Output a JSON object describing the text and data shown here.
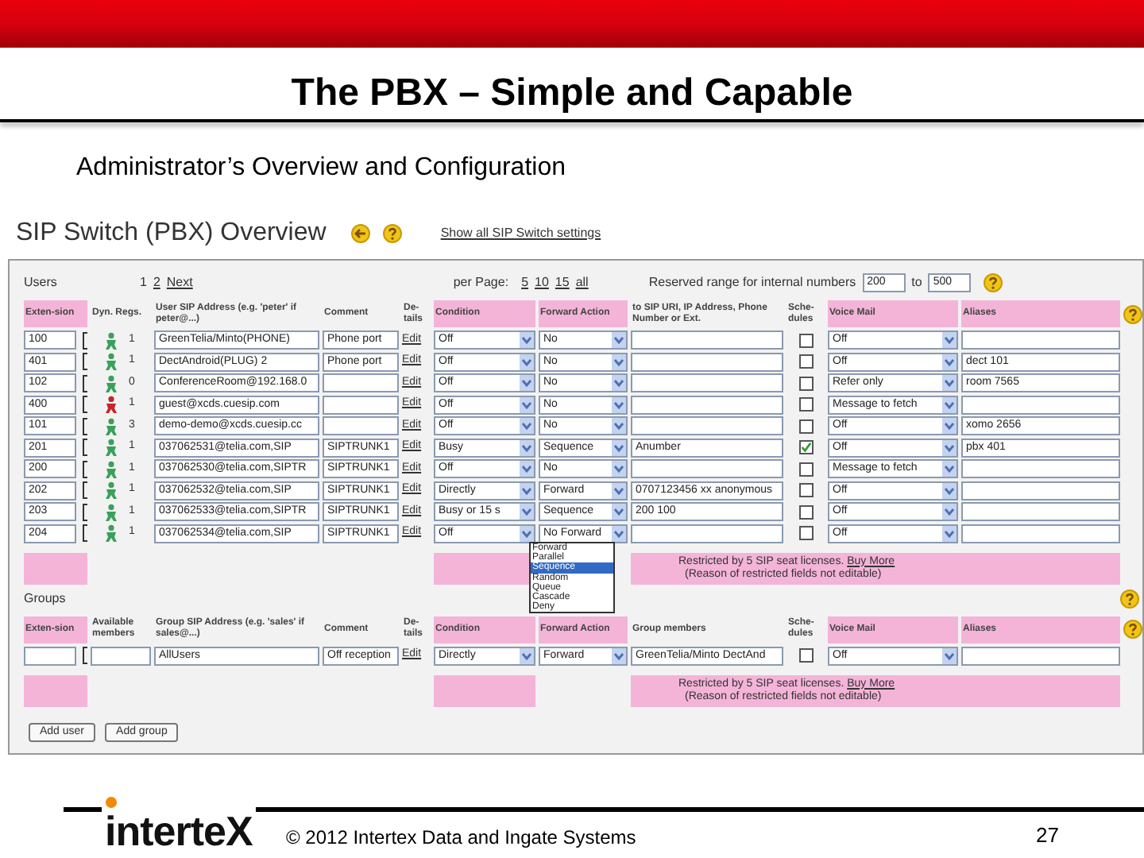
{
  "slide": {
    "title": "The PBX – Simple and Capable",
    "subtitle": "Administrator’s Overview and Configuration"
  },
  "app": {
    "title": "SIP Switch (PBX) Overview",
    "settings_link": "Show all SIP Switch settings",
    "users": {
      "heading": "Users",
      "pages": [
        {
          "label": "1",
          "selected": true
        },
        {
          "label": "2",
          "selected": false
        },
        {
          "label": "Next",
          "selected": false
        }
      ],
      "per_page_label": "per Page:",
      "per_page": [
        "5",
        "10",
        "15",
        "all"
      ],
      "reserved_label": "Reserved range for internal numbers",
      "reserved_from": "200",
      "reserved_to_label": "to",
      "reserved_to": "500",
      "columns": [
        {
          "label": "Exten-sion",
          "highlighted": true
        },
        {
          "label": "Dyn. Regs.",
          "highlighted": false
        },
        {
          "label": "User SIP Address (e.g. 'peter' if peter@...)",
          "highlighted": false
        },
        {
          "label": "Comment",
          "highlighted": false
        },
        {
          "label": "De-tails",
          "highlighted": false
        },
        {
          "label": "Condition",
          "highlighted": true
        },
        {
          "label": "Forward Action",
          "highlighted": true
        },
        {
          "label": "to SIP URI, IP Address, Phone Number or Ext.",
          "highlighted": false
        },
        {
          "label": "Sche-dules",
          "highlighted": false
        },
        {
          "label": "Voice Mail",
          "highlighted": true
        },
        {
          "label": "Aliases",
          "highlighted": true
        }
      ],
      "rows": [
        {
          "extension": "100",
          "registered": true,
          "regs": "1",
          "sip": "GreenTelia/Minto(PHONE)",
          "comment": "Phone port",
          "details": "Edit",
          "condition": "Off",
          "forward": "No",
          "to": "",
          "schedule": false,
          "voicemail": "Off",
          "alias": ""
        },
        {
          "extension": "401",
          "registered": true,
          "regs": "1",
          "sip": "DectAndroid(PLUG) 2",
          "comment": "Phone port",
          "details": "Edit",
          "condition": "Off",
          "forward": "No",
          "to": "",
          "schedule": false,
          "voicemail": "Off",
          "alias": "dect 101"
        },
        {
          "extension": "102",
          "registered": true,
          "regs": "0",
          "sip": "ConferenceRoom@192.168.0",
          "comment": "",
          "details": "Edit",
          "condition": "Off",
          "forward": "No",
          "to": "",
          "schedule": false,
          "voicemail": "Refer only",
          "alias": "room 7565"
        },
        {
          "extension": "400",
          "registered": false,
          "regs": "1",
          "sip": "guest@xcds.cuesip.com",
          "comment": "",
          "details": "Edit",
          "condition": "Off",
          "forward": "No",
          "to": "",
          "schedule": false,
          "voicemail": "Message to fetch",
          "alias": ""
        },
        {
          "extension": "101",
          "registered": true,
          "regs": "3",
          "sip": "demo-demo@xcds.cuesip.cc",
          "comment": "",
          "details": "Edit",
          "condition": "Off",
          "forward": "No",
          "to": "",
          "schedule": false,
          "voicemail": "Off",
          "alias": "xomo 2656"
        },
        {
          "extension": "201",
          "registered": true,
          "regs": "1",
          "sip": "037062531@telia.com,SIP",
          "comment": "SIPTRUNK1",
          "details": "Edit",
          "condition": "Busy",
          "forward": "Sequence",
          "to": "Anumber",
          "schedule": true,
          "voicemail": "Off",
          "alias": "pbx 401"
        },
        {
          "extension": "200",
          "registered": true,
          "regs": "1",
          "sip": "037062530@telia.com,SIPTR",
          "comment": "SIPTRUNK1",
          "details": "Edit",
          "condition": "Off",
          "forward": "No",
          "to": "",
          "schedule": false,
          "voicemail": "Message to fetch",
          "alias": ""
        },
        {
          "extension": "202",
          "registered": true,
          "regs": "1",
          "sip": "037062532@telia.com,SIP",
          "comment": "SIPTRUNK1",
          "details": "Edit",
          "condition": "Directly",
          "forward": "Forward",
          "to": "0707123456 xx anonymous",
          "schedule": false,
          "voicemail": "Off",
          "alias": ""
        },
        {
          "extension": "203",
          "registered": true,
          "regs": "1",
          "sip": "037062533@telia.com,SIPTR",
          "comment": "SIPTRUNK1",
          "details": "Edit",
          "condition": "Busy or 15 s",
          "forward": "Sequence",
          "to": "200 100",
          "schedule": false,
          "voicemail": "Off",
          "alias": ""
        },
        {
          "extension": "204",
          "registered": true,
          "regs": "1",
          "sip": "037062534@telia.com,SIP",
          "comment": "SIPTRUNK1",
          "details": "Edit",
          "condition": "Off",
          "forward": "No Forward",
          "to": "",
          "schedule": false,
          "voicemail": "Off",
          "alias": ""
        }
      ],
      "forward_options": [
        {
          "label": "Forward",
          "selected": false
        },
        {
          "label": "Parallel",
          "selected": false
        },
        {
          "label": "Sequence",
          "selected": true
        },
        {
          "label": "Random",
          "selected": false
        },
        {
          "label": "Queue",
          "selected": false
        },
        {
          "label": "Cascade",
          "selected": false
        },
        {
          "label": "Deny",
          "selected": false
        }
      ],
      "note": {
        "text": "Restricted by 5 SIP seat licenses.",
        "link": "Buy More",
        "reason": "(Reason of restricted fields not editable)"
      }
    },
    "groups": {
      "heading": "Groups",
      "columns": [
        {
          "label": "Exten-sion",
          "highlighted": true
        },
        {
          "label": "Available members",
          "highlighted": false
        },
        {
          "label": "Group SIP Address (e.g. 'sales' if sales@...)",
          "highlighted": false
        },
        {
          "label": "Comment",
          "highlighted": false
        },
        {
          "label": "De-tails",
          "highlighted": false
        },
        {
          "label": "Condition",
          "highlighted": true
        },
        {
          "label": "Forward Action",
          "highlighted": true
        },
        {
          "label": "Group members",
          "highlighted": false
        },
        {
          "label": "Sche-dules",
          "highlighted": false
        },
        {
          "label": "Voice Mail",
          "highlighted": true
        },
        {
          "label": "Aliases",
          "highlighted": true
        }
      ],
      "rows": [
        {
          "extension": "",
          "members_available": "",
          "sip": "AllUsers",
          "comment": "Off reception",
          "details": "Edit",
          "condition": "Directly",
          "forward": "Forward",
          "members": "GreenTelia/Minto DectAnd",
          "schedule": false,
          "voicemail": "Off",
          "alias": ""
        }
      ],
      "note": {
        "text": "Restricted by 5 SIP seat licenses.",
        "link": "Buy More",
        "reason": "(Reason of restricted fields not editable)"
      }
    },
    "buttons": [
      "Add user",
      "Add group"
    ]
  },
  "footer": {
    "logo": "interteX",
    "copyright": "© 2012 Intertex Data and Ingate Systems",
    "page": "27"
  }
}
